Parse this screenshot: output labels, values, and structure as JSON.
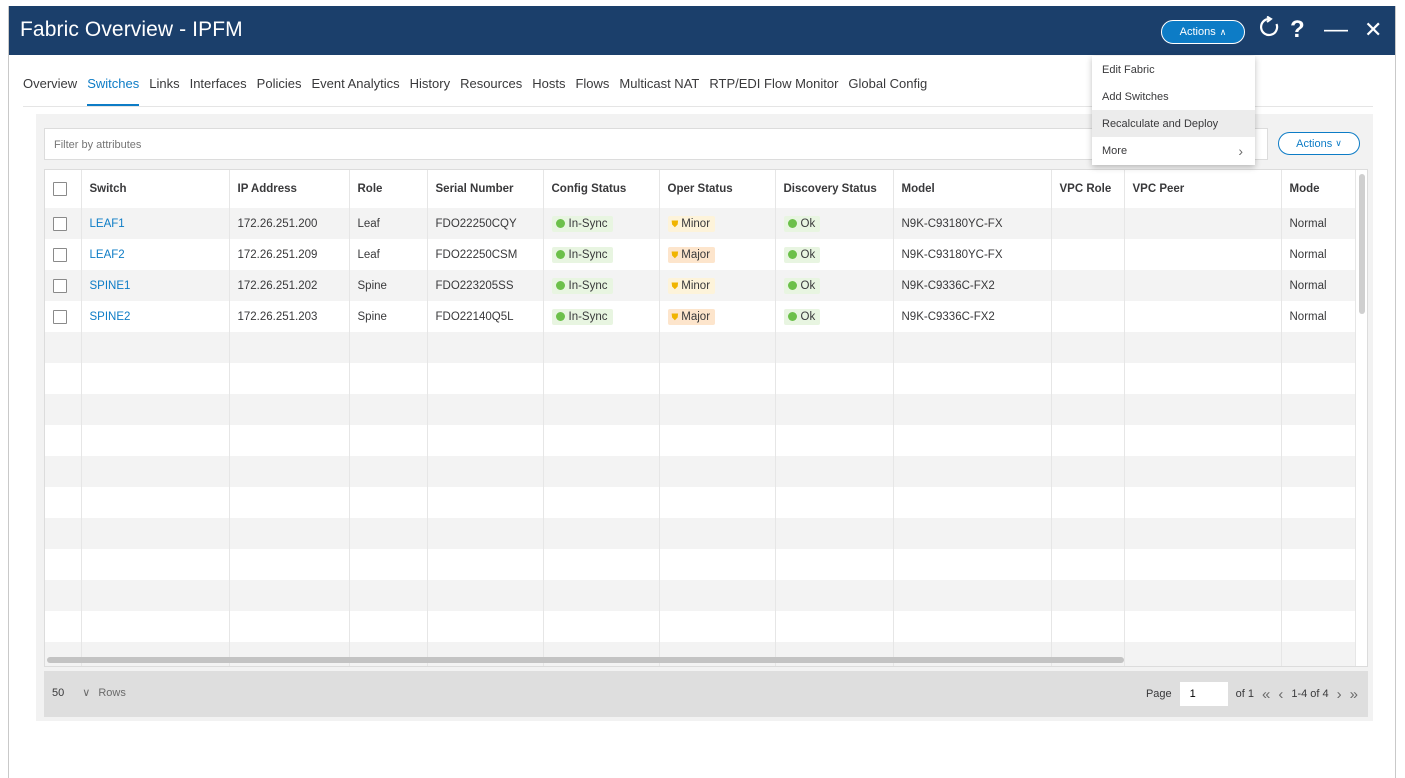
{
  "window": {
    "title": "Fabric Overview - IPFM"
  },
  "header": {
    "actions_label": "Actions",
    "icons": [
      "refresh-icon",
      "help-icon",
      "minimize-icon",
      "close-icon"
    ],
    "help_glyph": "?",
    "minimize_glyph": "—",
    "close_glyph": "✕"
  },
  "actions_menu": {
    "items": [
      {
        "label": "Edit Fabric"
      },
      {
        "label": "Add Switches"
      },
      {
        "label": "Recalculate and Deploy"
      },
      {
        "label": "More"
      }
    ]
  },
  "tabs": [
    {
      "label": "Overview"
    },
    {
      "label": "Switches",
      "active": true
    },
    {
      "label": "Links"
    },
    {
      "label": "Interfaces"
    },
    {
      "label": "Policies"
    },
    {
      "label": "Event Analytics"
    },
    {
      "label": "History"
    },
    {
      "label": "Resources"
    },
    {
      "label": "Hosts"
    },
    {
      "label": "Flows"
    },
    {
      "label": "Multicast NAT"
    },
    {
      "label": "RTP/EDI Flow Monitor"
    },
    {
      "label": "Global Config"
    }
  ],
  "filter": {
    "placeholder": "Filter by attributes"
  },
  "panel_actions_label": "Actions",
  "table": {
    "columns": [
      "Switch",
      "IP Address",
      "Role",
      "Serial Number",
      "Config Status",
      "Oper Status",
      "Discovery Status",
      "Model",
      "VPC Role",
      "VPC Peer",
      "Mode"
    ],
    "rows": [
      {
        "switch": "LEAF1",
        "ip": "172.26.251.200",
        "role": "Leaf",
        "serial": "FDO22250CQY",
        "config": "In-Sync",
        "oper": "Minor",
        "discovery": "Ok",
        "model": "N9K-C93180YC-FX",
        "vpc_role": "",
        "vpc_peer": "",
        "mode": "Normal"
      },
      {
        "switch": "LEAF2",
        "ip": "172.26.251.209",
        "role": "Leaf",
        "serial": "FDO22250CSM",
        "config": "In-Sync",
        "oper": "Major",
        "discovery": "Ok",
        "model": "N9K-C93180YC-FX",
        "vpc_role": "",
        "vpc_peer": "",
        "mode": "Normal"
      },
      {
        "switch": "SPINE1",
        "ip": "172.26.251.202",
        "role": "Spine",
        "serial": "FDO223205SS",
        "config": "In-Sync",
        "oper": "Minor",
        "discovery": "Ok",
        "model": "N9K-C9336C-FX2",
        "vpc_role": "",
        "vpc_peer": "",
        "mode": "Normal"
      },
      {
        "switch": "SPINE2",
        "ip": "172.26.251.203",
        "role": "Spine",
        "serial": "FDO22140Q5L",
        "config": "In-Sync",
        "oper": "Major",
        "discovery": "Ok",
        "model": "N9K-C9336C-FX2",
        "vpc_role": "",
        "vpc_peer": "",
        "mode": "Normal"
      }
    ]
  },
  "footer": {
    "rows_value": "50",
    "rows_label": "Rows",
    "page_label": "Page",
    "page_value": "1",
    "of_label": "of 1",
    "range_label": "1-4 of 4"
  },
  "colors": {
    "titlebar": "#1b3f6b",
    "accent": "#0d7cc6",
    "ok": "#6cc04a",
    "minor": "#f0b400"
  }
}
